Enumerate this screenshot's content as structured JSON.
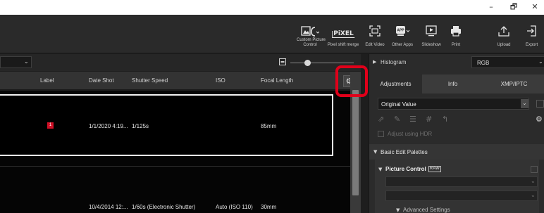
{
  "window": {
    "minimize": "–",
    "maximize": "🗗",
    "close": "✕"
  },
  "toolbar": {
    "tools": [
      {
        "name": "custom-picture-control",
        "label": "Custom Picture Control",
        "icon": "custom-picture-control-icon"
      },
      {
        "name": "pixel-shift-merge",
        "label": "Pixel shift merge",
        "icon": "pixel-shift-icon"
      },
      {
        "name": "edit-video",
        "label": "Edit Video",
        "icon": "edit-video-icon"
      },
      {
        "name": "other-apps",
        "label": "Other Apps",
        "icon": "other-apps-icon"
      },
      {
        "name": "slideshow",
        "label": "Slideshow",
        "icon": "slideshow-icon"
      },
      {
        "name": "print",
        "label": "Print",
        "icon": "print-icon"
      },
      {
        "name": "upload",
        "label": "Upload",
        "icon": "upload-icon"
      },
      {
        "name": "export",
        "label": "Export",
        "icon": "export-icon"
      }
    ],
    "cpc_line1": "Custom Picture",
    "cpc_line2": "Control",
    "pixel_text": "PiXEL",
    "app_badge": "APP"
  },
  "table": {
    "columns": {
      "label": "Label",
      "date_shot": "Date Shot",
      "shutter_speed": "Shutter Speed",
      "iso": "ISO",
      "focal_length": "Focal Length"
    },
    "rows": [
      {
        "label": "1",
        "date_shot": "1/1/2020 4:19...",
        "shutter_speed": "1/125s",
        "iso": "",
        "focal_length": "85mm",
        "selected": true
      },
      {
        "label": "",
        "date_shot": "10/4/2014 12:...",
        "shutter_speed": "1/60s (Electronic Shutter)",
        "iso": "Auto (ISO 110)",
        "focal_length": "30mm",
        "selected": false
      }
    ]
  },
  "panel": {
    "histogram_label": "Histogram",
    "histogram_channel": "RGB",
    "tabs": [
      "Adjustments",
      "Info",
      "XMP/IPTC"
    ],
    "active_tab": "Adjustments",
    "preset_value": "Original Value",
    "hdr_label": "Adjust using HDR",
    "section_basic": "Basic Edit Palettes",
    "section_picture_control": "Picture Control",
    "raw_badge": "RAW",
    "section_advanced": "Advanced Settings"
  },
  "colors": {
    "accent_red": "#e0001a",
    "label_red": "#cf1026",
    "selection_border": "#f2f2f2"
  }
}
